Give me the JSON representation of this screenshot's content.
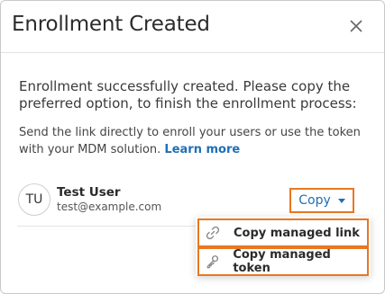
{
  "dialog": {
    "title": "Enrollment Created",
    "message": "Enrollment successfully created. Please copy the preferred option, to finish the enrollment process:",
    "sub_text": "Send the link directly to enroll your users or use the token with your MDM solution.",
    "learn_more": "Learn more"
  },
  "user": {
    "initials": "TU",
    "name": "Test User",
    "email": "test@example.com"
  },
  "copy_button": {
    "label": "Copy"
  },
  "copy_menu": {
    "items": [
      {
        "label": "Copy managed link",
        "icon": "link-icon"
      },
      {
        "label": "Copy managed token",
        "icon": "key-icon"
      }
    ]
  },
  "colors": {
    "accent": "#1f6fb5",
    "highlight": "#e87722"
  }
}
